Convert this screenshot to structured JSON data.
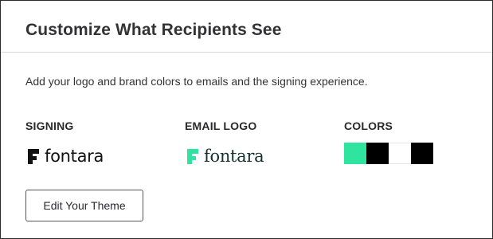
{
  "card": {
    "title": "Customize What Recipients See",
    "description": "Add your logo and brand colors to emails and the signing experience."
  },
  "columns": {
    "signing": {
      "heading": "SIGNING",
      "logo_text": "fontara",
      "logo_color": "#111111"
    },
    "email_logo": {
      "heading": "EMAIL LOGO",
      "logo_text": "fontara",
      "logo_color": "#2fe4a0"
    },
    "colors": {
      "heading": "COLORS",
      "swatches": [
        {
          "name": "swatch-green",
          "color": "#2ee49e"
        },
        {
          "name": "swatch-black",
          "color": "#000000"
        },
        {
          "name": "swatch-white",
          "color": "#ffffff"
        },
        {
          "name": "swatch-black-2",
          "color": "#000000"
        }
      ]
    }
  },
  "actions": {
    "edit_theme_label": "Edit Your Theme"
  }
}
